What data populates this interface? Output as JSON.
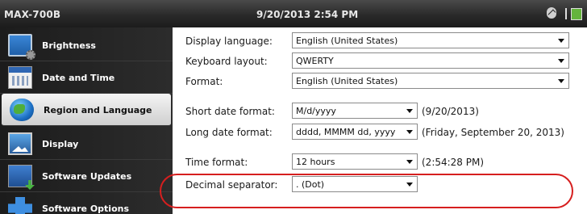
{
  "titlebar": {
    "app_name": "MAX-700B",
    "clock": "9/20/2013 2:54 PM",
    "icons": [
      "bluetooth-icon",
      "battery-icon"
    ]
  },
  "sidebar": {
    "items": [
      {
        "label": "Brightness",
        "icon": "monitor-settings-icon",
        "active": false
      },
      {
        "label": "Date and Time",
        "icon": "calendar-icon",
        "active": false
      },
      {
        "label": "Region and Language",
        "icon": "globe-icon",
        "active": true
      },
      {
        "label": "Display",
        "icon": "display-icon",
        "active": false
      },
      {
        "label": "Software Updates",
        "icon": "software-update-icon",
        "active": false
      },
      {
        "label": "Software Options",
        "icon": "puzzle-options-icon",
        "active": false
      }
    ]
  },
  "settings": {
    "display_language": {
      "label": "Display language:",
      "value": "English (United States)"
    },
    "keyboard_layout": {
      "label": "Keyboard layout:",
      "value": "QWERTY"
    },
    "format": {
      "label": "Format:",
      "value": "English (United States)"
    },
    "short_date_format": {
      "label": "Short date format:",
      "value": "M/d/yyyy",
      "sample": "(9/20/2013)"
    },
    "long_date_format": {
      "label": "Long date format:",
      "value": "dddd, MMMM dd, yyyy",
      "sample": "(Friday, September 20, 2013)"
    },
    "time_format": {
      "label": "Time format:",
      "value": "12 hours",
      "sample": "(2:54:28 PM)"
    },
    "decimal_separator": {
      "label": "Decimal separator:",
      "value": ". (Dot)"
    }
  },
  "colors": {
    "highlight_ring": "#d61f1f",
    "active_item_bg": "#e6e6e6",
    "sidebar_bg": "#222222"
  }
}
